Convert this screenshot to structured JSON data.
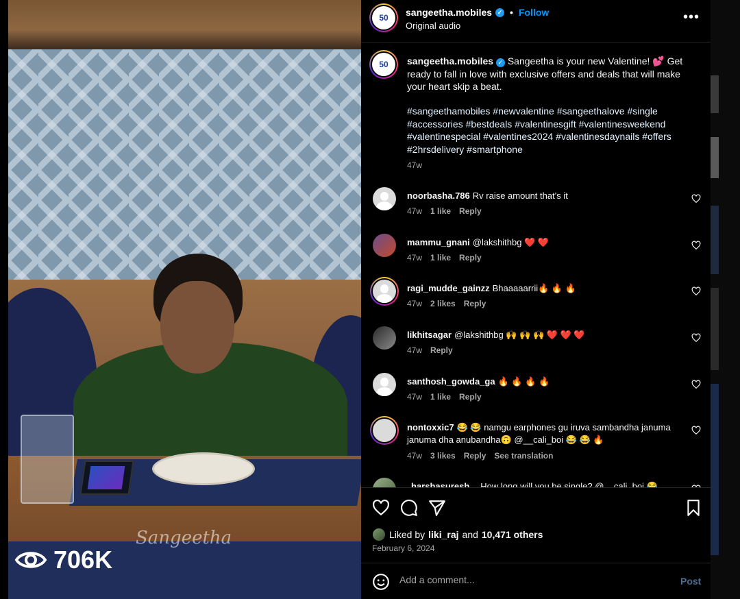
{
  "media": {
    "watermark": "Sangeetha",
    "views_icon": "eye-icon",
    "view_count": "706K"
  },
  "header": {
    "username": "sangeetha.mobiles",
    "verified": true,
    "follow_label": "Follow",
    "audio_label": "Original audio",
    "more_icon": "more-options-icon",
    "dot": "•"
  },
  "caption": {
    "username": "sangeetha.mobiles",
    "text": "Sangeetha is your new Valentine! 💕 Get ready to fall in love with exclusive offers and deals that will make your heart skip a beat.",
    "hashtags": "#sangeethamobiles #newvalentine #sangeethalove #single #accessories #bestdeals #valentinesgift #valentinesweekend #valentinespecial #valentines2024 #valentinesdaynails #offers #2hrsdelivery #smartphone",
    "time": "47w"
  },
  "comments": [
    {
      "username": "noorbasha.786",
      "text": "Rv raise amount that's it",
      "time": "47w",
      "likes": "1 like",
      "reply": "Reply",
      "avatar": "default"
    },
    {
      "username": "mammu_gnani",
      "text": "@lakshithbg ❤️ ❤️",
      "time": "47w",
      "likes": "1 like",
      "reply": "Reply",
      "avatar": "photo"
    },
    {
      "username": "ragi_mudde_gainzz",
      "text": "Bhaaaaarrii🔥 🔥 🔥",
      "time": "47w",
      "likes": "2 likes",
      "reply": "Reply",
      "avatar": "default-ring"
    },
    {
      "username": "likhitsagar",
      "text": "@lakshithbg 🙌 🙌 🙌 ❤️ ❤️ ❤️",
      "time": "47w",
      "likes": "",
      "reply": "Reply",
      "avatar": "photo"
    },
    {
      "username": "santhosh_gowda_ga",
      "text": "🔥 🔥 🔥 🔥",
      "time": "47w",
      "likes": "1 like",
      "reply": "Reply",
      "avatar": "default"
    },
    {
      "username": "nontoxxic7",
      "text": "😂 😂 namgu earphones gu iruva sambandha januma januma dha anubandha🙃 @__cali_boi 😂 😂 🔥",
      "time": "47w",
      "likes": "3 likes",
      "reply": "Reply",
      "translate": "See translation",
      "avatar": "photo-ring"
    },
    {
      "username": "harshasuresh",
      "text": "How long will you be single? @__cali_boi 😂",
      "avatar": "photo"
    }
  ],
  "actions": {
    "like_icon": "heart-icon",
    "comment_icon": "comment-icon",
    "share_icon": "share-icon",
    "save_icon": "bookmark-icon",
    "liked_by_prefix": "Liked by",
    "liked_by_user": "liki_raj",
    "and": "and",
    "others": "10,471 others",
    "date": "February 6, 2024"
  },
  "add_comment": {
    "emoji_icon": "emoji-icon",
    "placeholder": "Add a comment...",
    "post_label": "Post"
  }
}
